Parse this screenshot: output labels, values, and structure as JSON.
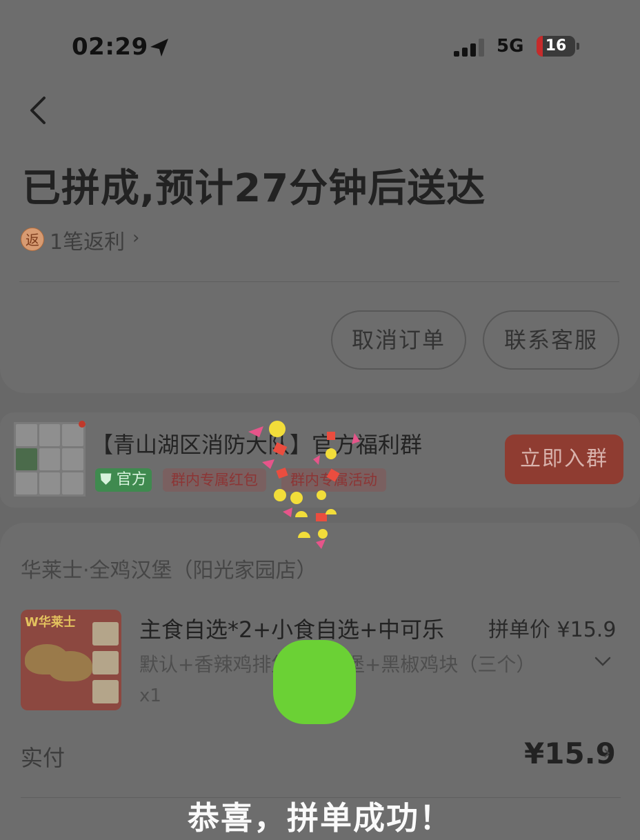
{
  "status_bar": {
    "time": "02:29",
    "network": "5G",
    "battery": "16"
  },
  "header": {
    "title": "已拼成,预计27分钟后送达",
    "rebate_icon": "返",
    "rebate_text": "1笔返利",
    "rebate_chevron": "›",
    "cancel_label": "取消订单",
    "service_label": "联系客服"
  },
  "group": {
    "name": "【青山湖区消防大队】官方福利群",
    "official_tag": "官方",
    "tags": [
      "群内专属红包",
      "群内专属活动"
    ],
    "join_label": "立即入群"
  },
  "order": {
    "store": "华莱士·全鸡汉堡（阳光家园店）",
    "product": {
      "brand": "W华莱士",
      "name": "主食自选*2+小食自选+中可乐",
      "price_label": "拼单价 ¥15.9",
      "spec": "默认+香辣鸡排堡+鸡排堡+黑椒鸡块（三个）",
      "qty": "x1"
    },
    "paid_label": "实付",
    "paid_amount": "¥15.9",
    "paid_chevron": "›"
  },
  "overlay": {
    "message": "恭喜，拼单成功！"
  },
  "colors": {
    "overlay_dim": "#686868",
    "success_green": "#6bd135",
    "join_red": "#8f3c31"
  },
  "icons": [
    "location-arrow-icon",
    "signal-icon",
    "battery-icon",
    "back-chevron-icon",
    "chevron-down-icon"
  ]
}
